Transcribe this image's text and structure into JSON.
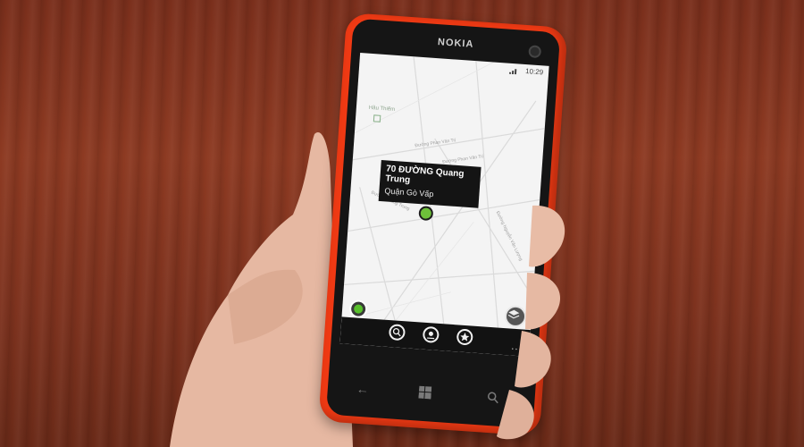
{
  "phone": {
    "brand": "NOKIA"
  },
  "status_bar": {
    "time": "10:29"
  },
  "map": {
    "poi_label": "Hầu Thiếm",
    "road_labels": [
      "Đường Phan Văn Trị",
      "Đường Phan Văn Trị",
      "Đường Quang Trung",
      "Đường Nguyễn Văn Lượng"
    ]
  },
  "location_callout": {
    "title": "70 ĐƯỜNG Quang Trung",
    "subtitle": "Quận Gò Vấp"
  },
  "app_bar": {
    "more": "..."
  },
  "colors": {
    "phone_body": "#f03a14",
    "pin": "#6ec03a",
    "wood": "#8d3a22"
  },
  "icons": [
    "search-icon",
    "location-icon",
    "star-icon",
    "layers-icon",
    "back-icon",
    "windows-icon",
    "hardware-search-icon",
    "gps-icon",
    "signal-icon"
  ]
}
